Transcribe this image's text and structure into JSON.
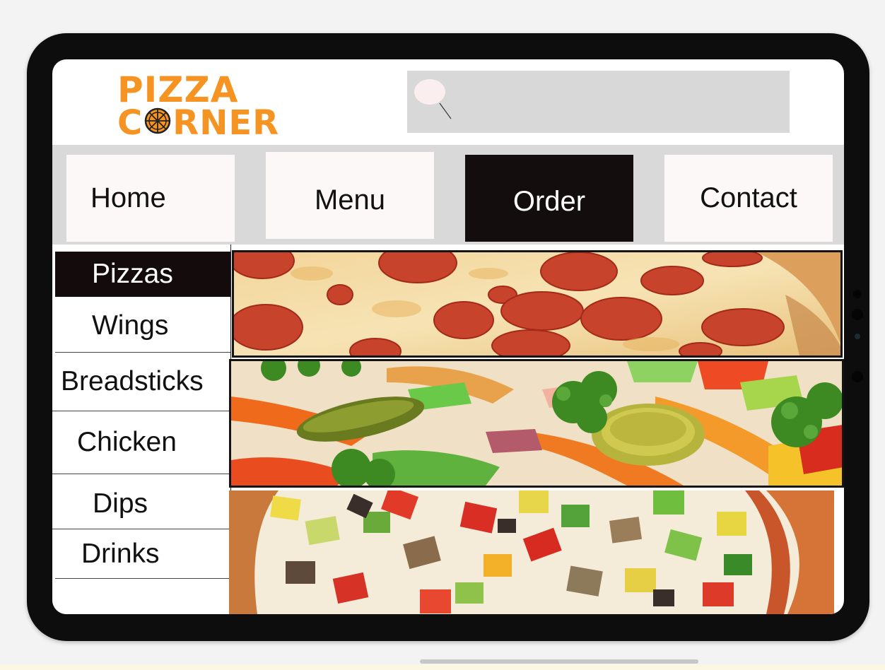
{
  "brand": {
    "line1": "PIZZA",
    "line2_start": "C",
    "line2_end": "RNER",
    "color": "#f59323"
  },
  "search": {
    "placeholder": "",
    "icon": "search-icon"
  },
  "nav": {
    "items": [
      {
        "label": "Home",
        "active": false
      },
      {
        "label": "Menu",
        "active": false
      },
      {
        "label": "Order",
        "active": true
      },
      {
        "label": "Contact",
        "active": false
      }
    ]
  },
  "sidebar": {
    "items": [
      {
        "label": "Pizzas",
        "active": true
      },
      {
        "label": "Wings",
        "active": false
      },
      {
        "label": "Breadsticks",
        "active": false
      },
      {
        "label": "Chicken",
        "active": false
      },
      {
        "label": "Dips",
        "active": false
      },
      {
        "label": "Drinks",
        "active": false
      }
    ]
  },
  "panels": [
    {
      "subject": "pepperoni-pizza-image"
    },
    {
      "subject": "vegetable-toppings-image"
    },
    {
      "subject": "veggie-pizza-image"
    }
  ],
  "colors": {
    "accent": "#f59323",
    "active_bg": "#140d0d",
    "nav_bg": "#d9d9d9",
    "button_bg": "#fbf8f7"
  }
}
